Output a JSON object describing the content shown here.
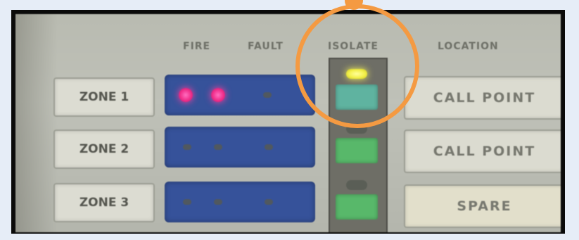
{
  "headers": {
    "fire": "FIRE",
    "fault": "FAULT",
    "isolate": "ISOLATE",
    "location": "LOCATION"
  },
  "zones": [
    {
      "label": "ZONE 1",
      "location": "CALL POINT",
      "fire_led": "on",
      "isolate_led": "yellow"
    },
    {
      "label": "ZONE 2",
      "location": "CALL POINT",
      "fire_led": "off",
      "isolate_led": "off"
    },
    {
      "label": "ZONE 3",
      "location": "SPARE",
      "fire_led": "off",
      "isolate_led": "off"
    }
  ],
  "colors": {
    "highlight_circle": "#f49a42",
    "fire_led_on": "#f02d8a",
    "isolate_led_on": "#f3f04a",
    "zone_bar": "#36529a",
    "isolate_button": "#58b86a"
  }
}
